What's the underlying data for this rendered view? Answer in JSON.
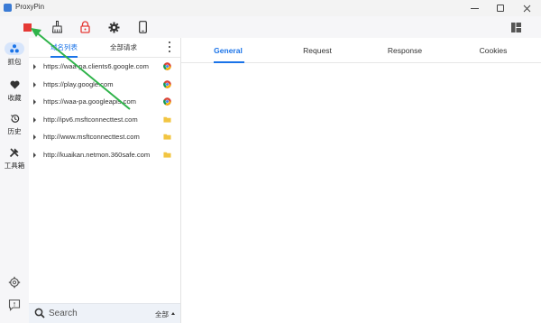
{
  "window": {
    "title": "ProxyPin"
  },
  "toolbar": {
    "icons": [
      "stop-icon",
      "broom-icon",
      "lock-icon",
      "gear-icon",
      "phone-icon",
      "layout-icon"
    ],
    "colors": {
      "stop": "#e53935",
      "lock": "#e53935"
    }
  },
  "nav": {
    "items": [
      {
        "label": "抓包",
        "icon": "capture-icon"
      },
      {
        "label": "收藏",
        "icon": "heart-icon"
      },
      {
        "label": "历史",
        "icon": "history-icon"
      },
      {
        "label": "工具箱",
        "icon": "tools-icon"
      }
    ]
  },
  "list": {
    "tabs": [
      "域名列表",
      "全部请求"
    ],
    "rows": [
      {
        "url": "https://waa-pa.clients6.google.com",
        "icon": "chrome-icon"
      },
      {
        "url": "https://play.google.com",
        "icon": "chrome-icon"
      },
      {
        "url": "https://waa-pa.googleapis.com",
        "icon": "chrome-icon"
      },
      {
        "url": "http://ipv6.msftconnecttest.com",
        "icon": "folder-icon"
      },
      {
        "url": "http://www.msftconnecttest.com",
        "icon": "folder-icon"
      },
      {
        "url": "http://kuaikan.netmon.360safe.com",
        "icon": "folder-icon"
      }
    ]
  },
  "search": {
    "placeholder": "Search",
    "scope": "全部"
  },
  "detail": {
    "tabs": [
      "General",
      "Request",
      "Response",
      "Cookies"
    ]
  },
  "colors": {
    "accent": "#1a73e8",
    "annotation": "#2fb34a"
  }
}
